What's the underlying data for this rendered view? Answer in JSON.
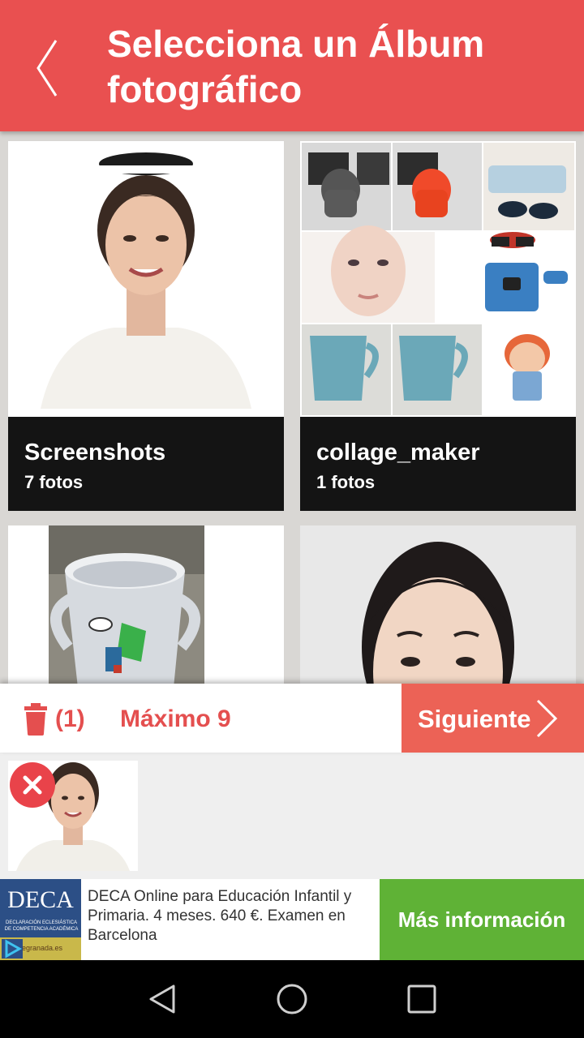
{
  "header": {
    "title": "Selecciona un Álbum fotográfico",
    "back_icon": "chevron-left-icon"
  },
  "albums": [
    {
      "name": "Screenshots",
      "count": "7 fotos"
    },
    {
      "name": "collage_maker",
      "count": "1 fotos"
    },
    {
      "name": "",
      "count": ""
    },
    {
      "name": "",
      "count": ""
    }
  ],
  "action_bar": {
    "trash_icon": "trash-icon",
    "selected_count": "(1)",
    "max_label": "Máximo 9",
    "next_label": "Siguiente",
    "next_icon": "chevron-right-icon"
  },
  "tray": {
    "remove_icon": "close-icon"
  },
  "ad": {
    "logo_text": "DECA",
    "logo_subtext": "DECLARACIÓN ECLESIÁSTICA DE COMPETENCIA ACADÉMICA",
    "logo_url": "onlinegranada.es",
    "text": "DECA Online para Educación Infantil y Primaria. 4 meses. 640 €. Examen en Barcelona",
    "cta": "Más información"
  },
  "nav": {
    "back_icon": "triangle-back-icon",
    "home_icon": "circle-home-icon",
    "recents_icon": "square-recents-icon"
  },
  "colors": {
    "header": "#e95050",
    "accent_text": "#e44f4f",
    "next_button": "#ec6256",
    "ad_cta": "#5fb236",
    "caption_bg": "#141414"
  }
}
